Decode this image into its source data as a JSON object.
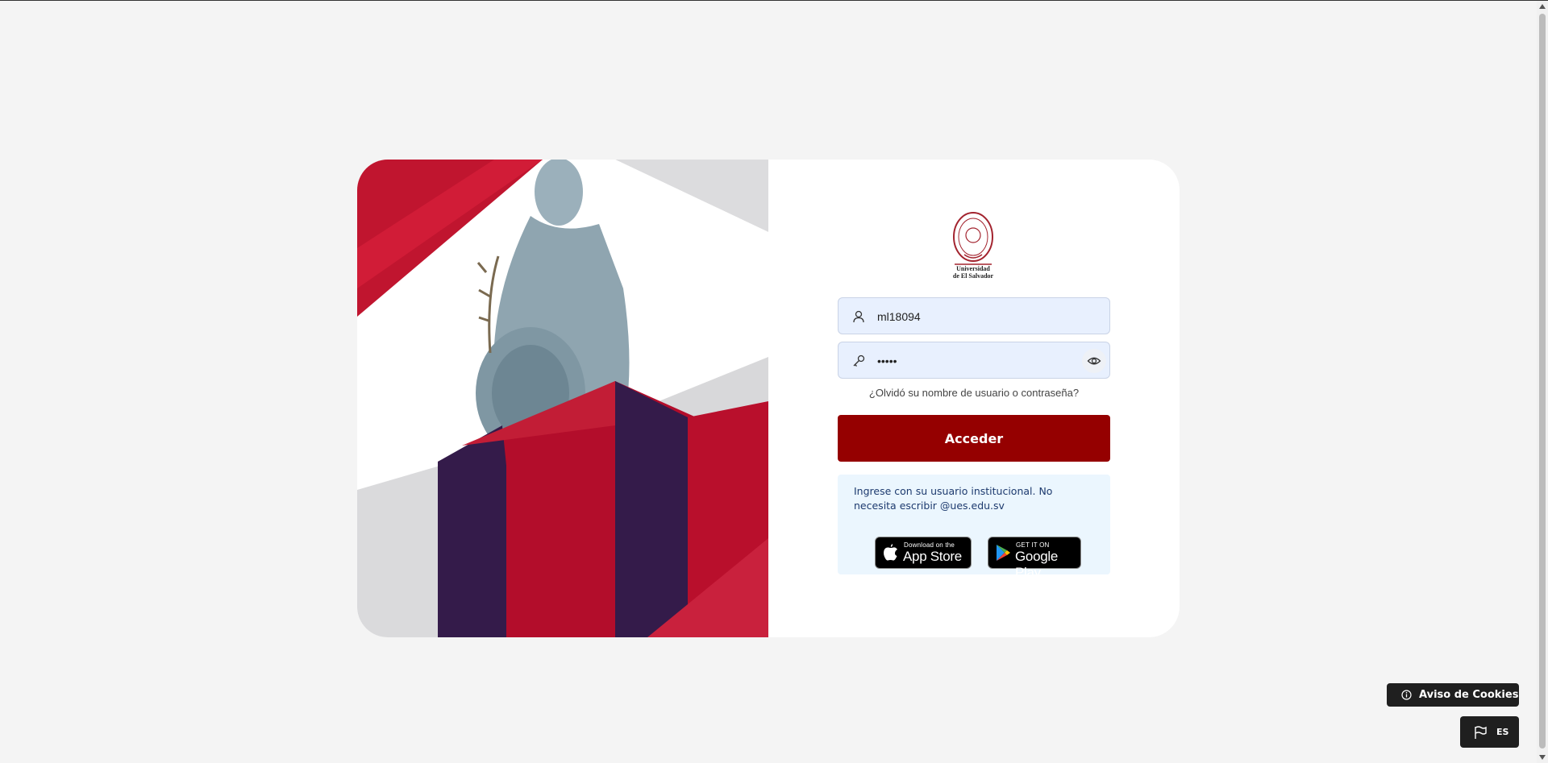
{
  "login": {
    "logo_text_line1": "Universidad",
    "logo_text_line2": "de El Salvador",
    "username_value": "ml18094",
    "password_value": "•••••",
    "forgot_link": "¿Olvidó su nombre de usuario o contraseña?",
    "submit_label": "Acceder",
    "info_text": "Ingrese con su usuario institucional. No necesita escribir @ues.edu.sv"
  },
  "stores": {
    "apple_small": "Download on the",
    "apple_big": "App Store",
    "google_small": "GET IT ON",
    "google_big": "Google Play"
  },
  "footer": {
    "cookie_label": "Aviso de Cookies",
    "language_label": "ES"
  },
  "colors": {
    "primary": "#950000",
    "accent_red": "#b30d2b",
    "accent_purple": "#341b4a",
    "info_bg": "#ebf6fe"
  },
  "icons": [
    "user-icon",
    "key-icon",
    "eye-icon",
    "apple-icon",
    "google-play-icon",
    "info-icon",
    "flag-icon"
  ]
}
